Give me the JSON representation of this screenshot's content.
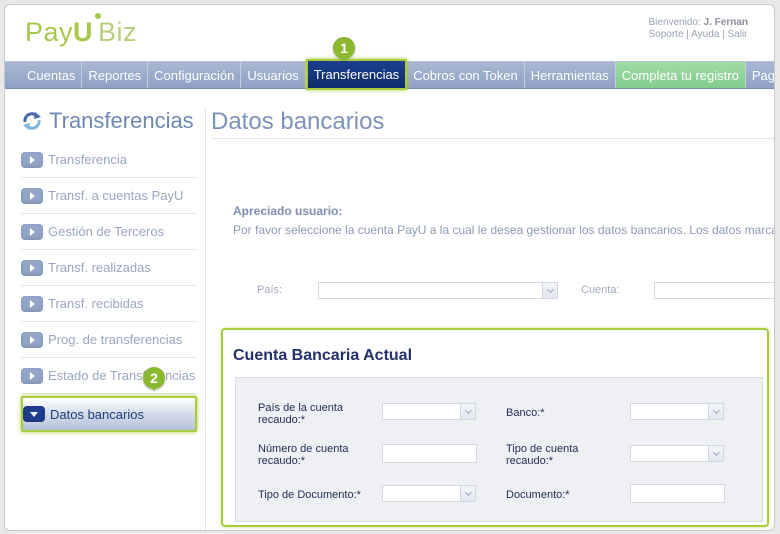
{
  "brand": {
    "logo_a": "Pay",
    "logo_u": "U",
    "logo_b": "Biz",
    "accent": "#a6c84a"
  },
  "user": {
    "greeting": "Bienvenido:",
    "name": "J. Fernan",
    "support": "Soporte",
    "help": "Ayuda",
    "logout": "Salir",
    "sep": "|"
  },
  "nav": {
    "items": [
      "Cuentas",
      "Reportes",
      "Configuración",
      "Usuarios",
      "Transferencias",
      "Cobros con Token",
      "Herramientas",
      "Completa tu registro",
      "Pagos R"
    ]
  },
  "markers": {
    "one": "1",
    "two": "2"
  },
  "sidebar": {
    "title": "Transferencias",
    "items": [
      "Transferencia",
      "Transf. a cuentas PayU",
      "Gestión de Terceros",
      "Transf. realizadas",
      "Transf. recibidas",
      "Prog. de transferencias",
      "Estado de Transferencias",
      "Datos bancarios"
    ]
  },
  "main": {
    "title": "Datos bancarios",
    "greeting": "Apreciado usuario:",
    "message": "Por favor seleccione la cuenta PayU a la cual le desea gestionar los datos bancarios. Los datos marcados",
    "country_label": "País:",
    "account_label": "Cuenta:"
  },
  "account": {
    "title": "Cuenta Bancaria Actual",
    "country_label": "País de la cuenta recaudo:*",
    "bank_label": "Banco:*",
    "number_label": "Número de cuenta recaudo:*",
    "type_label": "Tipo de cuenta recaudo:*",
    "doc_type_label": "Tipo de Documento:*",
    "doc_label": "Documento:*"
  }
}
